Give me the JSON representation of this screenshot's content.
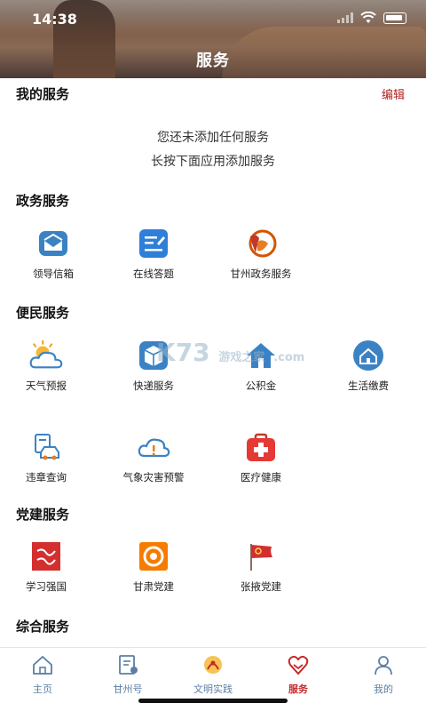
{
  "status_bar": {
    "time": "14:38"
  },
  "header": {
    "title": "服务"
  },
  "my_services": {
    "heading": "我的服务",
    "edit_label": "编辑",
    "empty_line1": "您还未添加任何服务",
    "empty_line2": "长按下面应用添加服务"
  },
  "government": {
    "heading": "政务服务",
    "items": [
      {
        "label": "领导信箱",
        "icon": "mail-icon"
      },
      {
        "label": "在线答题",
        "icon": "edit-note-icon"
      },
      {
        "label": "甘州政务服务",
        "icon": "gov-logo-icon"
      }
    ]
  },
  "convenience": {
    "heading": "便民服务",
    "items": [
      {
        "label": "天气预报",
        "icon": "weather-icon"
      },
      {
        "label": "快递服务",
        "icon": "package-icon"
      },
      {
        "label": "公积金",
        "icon": "house-fund-icon"
      },
      {
        "label": "生活缴费",
        "icon": "home-bill-icon"
      },
      {
        "label": "违章查询",
        "icon": "car-violation-icon"
      },
      {
        "label": "气象灾害预警",
        "icon": "weather-alert-icon"
      },
      {
        "label": "医疗健康",
        "icon": "medical-kit-icon"
      }
    ]
  },
  "party": {
    "heading": "党建服务",
    "items": [
      {
        "label": "学习强国",
        "icon": "xuexi-icon"
      },
      {
        "label": "甘肃党建",
        "icon": "gansu-party-icon"
      },
      {
        "label": "张掖党建",
        "icon": "party-flag-icon"
      }
    ]
  },
  "general": {
    "heading": "综合服务"
  },
  "watermark": {
    "text": "K73",
    "sub": "游戏之家",
    "domain": ".com"
  },
  "tabbar": {
    "tabs": [
      {
        "label": "主页",
        "icon": "home-icon"
      },
      {
        "label": "甘州号",
        "icon": "news-icon"
      },
      {
        "label": "文明实践",
        "icon": "wheat-emblem-icon"
      },
      {
        "label": "服务",
        "icon": "heart-service-icon",
        "active": true
      },
      {
        "label": "我的",
        "icon": "user-icon"
      }
    ]
  },
  "colors": {
    "accent": "#c62828",
    "icon_blue": "#3b82c4",
    "tab_inactive": "#5b7fa6"
  }
}
